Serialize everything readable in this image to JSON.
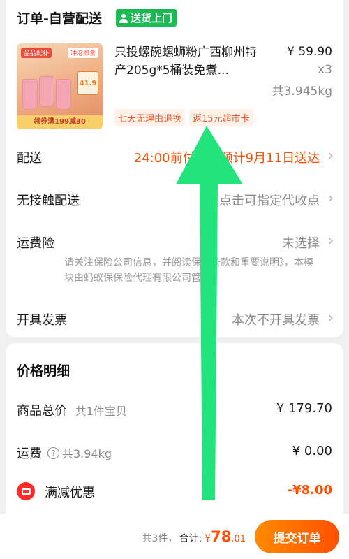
{
  "order_card": {
    "header_title": "订单-自营配送",
    "badge": "送货上门",
    "product": {
      "image_tag": "品品配补",
      "image_tag2": "冲泡即食",
      "image_price": "41.9",
      "image_coupon": "领券满199减30",
      "title": "只投螺碗螺蛳粉广西柳州特产205g*5桶装免煮...",
      "price": "¥ 59.90",
      "quantity": "x3",
      "weight": "共3.945kg",
      "service_tags": [
        "七天无理由退换",
        "返15元超市卡"
      ]
    },
    "rows": {
      "delivery": {
        "label": "配送",
        "value": "24:00前付款，预计9月11日送达"
      },
      "contactless": {
        "label": "无接触配送",
        "value": "点击可指定代收点"
      },
      "insurance": {
        "label": "运费险",
        "value": "未选择",
        "note": "请关注保险公司信息，并阅读保险条款和重要说明》，本模块由蚂蚁保保险代理有限公司管理。"
      },
      "invoice": {
        "label": "开具发票",
        "value": "本次不开具发票"
      }
    }
  },
  "price_card": {
    "title": "价格明细",
    "goods_total": {
      "label": "商品总价",
      "sub": "共1件宝贝",
      "value": "¥ 179.70"
    },
    "shipping": {
      "label": "运费",
      "help": "?",
      "sub": "共3.94kg",
      "value": "¥ 0.00"
    },
    "discount": {
      "label": "满减优惠",
      "value": "-¥8.00"
    }
  },
  "bottom_bar": {
    "count": "共3件，",
    "total_label": "合计:",
    "currency": "¥",
    "total_int": "78",
    "total_dec": ".01",
    "submit_label": "提交订单"
  },
  "colors": {
    "accent": "#ff5000",
    "green_badge": "#1cb954",
    "arrow": "#22e37c"
  },
  "icons": [
    "person-icon",
    "chevron-right-icon",
    "question-icon",
    "coupon-icon",
    "swipe-up-arrow-icon"
  ]
}
